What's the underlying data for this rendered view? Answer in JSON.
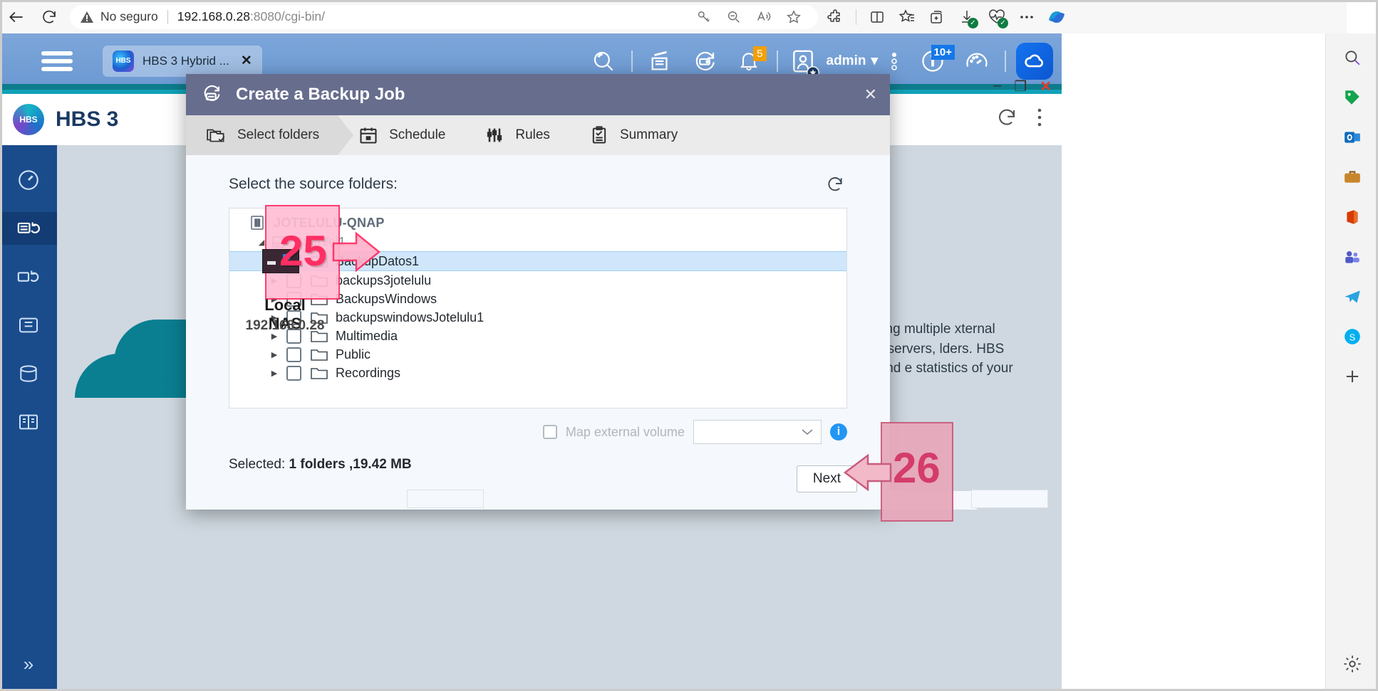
{
  "browser": {
    "back_label": "Back",
    "reload_label": "Reload",
    "security_label": "No seguro",
    "url_prefix": "192.168.0.28",
    "url_port": ":8080",
    "url_path": "/cgi-bin/",
    "icons": [
      "back-arrow-icon",
      "reload-icon",
      "warning-triangle-icon",
      "key-icon",
      "zoom-out-icon",
      "read-aloud-icon",
      "favorite-star-icon",
      "extensions-icon",
      "split-screen-icon",
      "collections-icon",
      "add-tab-icon",
      "downloads-icon",
      "browser-essentials-icon",
      "more-options-icon",
      "copilot-icon"
    ]
  },
  "os_sidebar": {
    "icons": [
      "search-icon",
      "green-tag-icon",
      "outlook-icon",
      "briefcase-icon",
      "office-icon",
      "teams-icon",
      "telegram-icon",
      "skype-icon",
      "add-icon",
      "settings-gear-icon"
    ]
  },
  "qnap": {
    "tab": {
      "label": "HBS 3 Hybrid ...",
      "logo_text": "HBS",
      "close": "✕"
    },
    "header_icons": [
      "search-icon",
      "notes-icon",
      "backup-station-icon",
      "bell-icon",
      "user-avatar-icon",
      "more-vertical-icon",
      "info-icon",
      "dashboard-gauge-icon",
      "qnap-cloud-icon"
    ],
    "notification_count": "5",
    "info_count": "10+",
    "user_name": "admin",
    "user_caret": "▾",
    "app_title": "HBS 3",
    "app_logo_text": "HBS",
    "window_controls": {
      "minimize": "–",
      "maximize": "❐",
      "close": "✕"
    },
    "app_actions": [
      "refresh-icon",
      "more-vertical-icon"
    ],
    "left_nav": [
      "overview-icon",
      "backup-restore-icon",
      "sync-icon",
      "storage-space-icon",
      "services-icon",
      "logs-icon"
    ],
    "left_nav_expand": "»",
    "description": "ation. Supporting multiple xternal drives, remote servers, lders. HBS offers simple and e statistics of your backup"
  },
  "dialog": {
    "title": "Create a Backup Job",
    "header_icon": "backup-job-icon",
    "close_label": "✕",
    "steps": [
      {
        "label": "Select folders",
        "icon": "folder-check-icon",
        "active": true
      },
      {
        "label": "Schedule",
        "icon": "calendar-icon",
        "active": false
      },
      {
        "label": "Rules",
        "icon": "sliders-icon",
        "active": false
      },
      {
        "label": "Summary",
        "icon": "clipboard-check-icon",
        "active": false
      }
    ],
    "source_label": "Select the source folders:",
    "refresh_icon": "refresh-icon",
    "tree": {
      "nas_name": "JOTELULU-QNAP",
      "volume_name": "DataVol1",
      "folders": [
        {
          "name": "BackupDatos1",
          "checked": true,
          "selected": true
        },
        {
          "name": "backups3jotelulu",
          "checked": false,
          "selected": false
        },
        {
          "name": "BackupsWindows",
          "checked": false,
          "selected": false
        },
        {
          "name": "backupswindowsJotelulu1",
          "checked": false,
          "selected": false
        },
        {
          "name": "Multimedia",
          "checked": false,
          "selected": false
        },
        {
          "name": "Public",
          "checked": false,
          "selected": false
        },
        {
          "name": "Recordings",
          "checked": false,
          "selected": false
        }
      ]
    },
    "map_external_label": "Map external volume",
    "map_external_value": "",
    "map_info_icon": "info-icon",
    "selected_prefix": "Selected:",
    "selected_value": "1 folders ,19.42 MB",
    "next_label": "Next"
  },
  "annotations": {
    "step_25": {
      "number": "25",
      "caption": "Local NAS",
      "ip": "192.168.0.28"
    },
    "step_26": {
      "number": "26"
    }
  },
  "colors": {
    "qnap_header": "#7ba5d9",
    "dialog_header": "#676d8d",
    "left_nav": "#1a4c8c",
    "selected_row": "#cfe6fb",
    "checkbox_blue": "#1a73e8",
    "badge_orange": "#f2a007",
    "badge_blue": "#1577e8",
    "annot_pink": "#ff2e63",
    "annot_rose": "#d43c6a"
  }
}
